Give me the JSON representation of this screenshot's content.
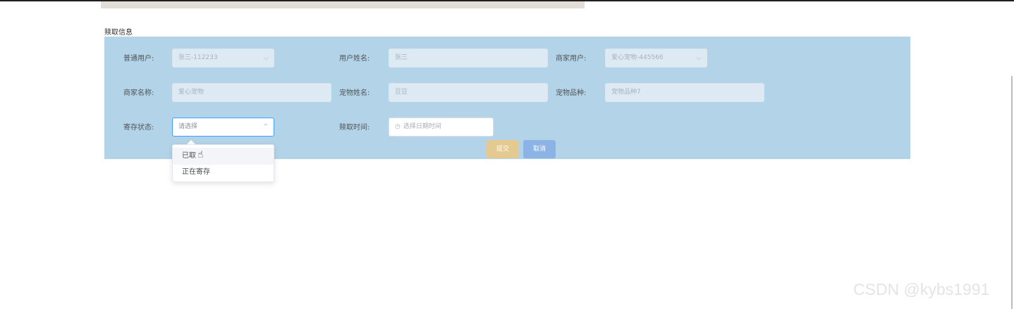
{
  "section_title": "赎取信息",
  "form": {
    "user": {
      "label": "普通用户:",
      "value": "张三-112233",
      "icon": "chevron-down-icon"
    },
    "username": {
      "label": "用户姓名:",
      "value": "张三"
    },
    "merchant": {
      "label": "商家用户:",
      "value": "爱心宠物-445566",
      "icon": "chevron-down-icon"
    },
    "shop_name": {
      "label": "商家名称:",
      "value": "爱心宠物"
    },
    "pet_name": {
      "label": "宠物姓名:",
      "value": "豆豆"
    },
    "pet_breed": {
      "label": "宠物品种:",
      "value": "宠物品种7"
    },
    "status": {
      "label": "寄存状态:",
      "placeholder": "请选择",
      "icon": "chevron-up-icon"
    },
    "redeem_time": {
      "label": "赎取时间:",
      "placeholder": "选择日期时间",
      "icon": "clock-icon"
    }
  },
  "buttons": {
    "submit": "提交",
    "cancel": "取消"
  },
  "dropdown": {
    "options": [
      "已取",
      "正在寄存"
    ]
  },
  "watermark": "CSDN @kybs1991",
  "colors": {
    "panel": "#b3d4e8",
    "submit": "#e4ca90",
    "cancel": "#8cb3e6",
    "accent": "#409eff"
  }
}
